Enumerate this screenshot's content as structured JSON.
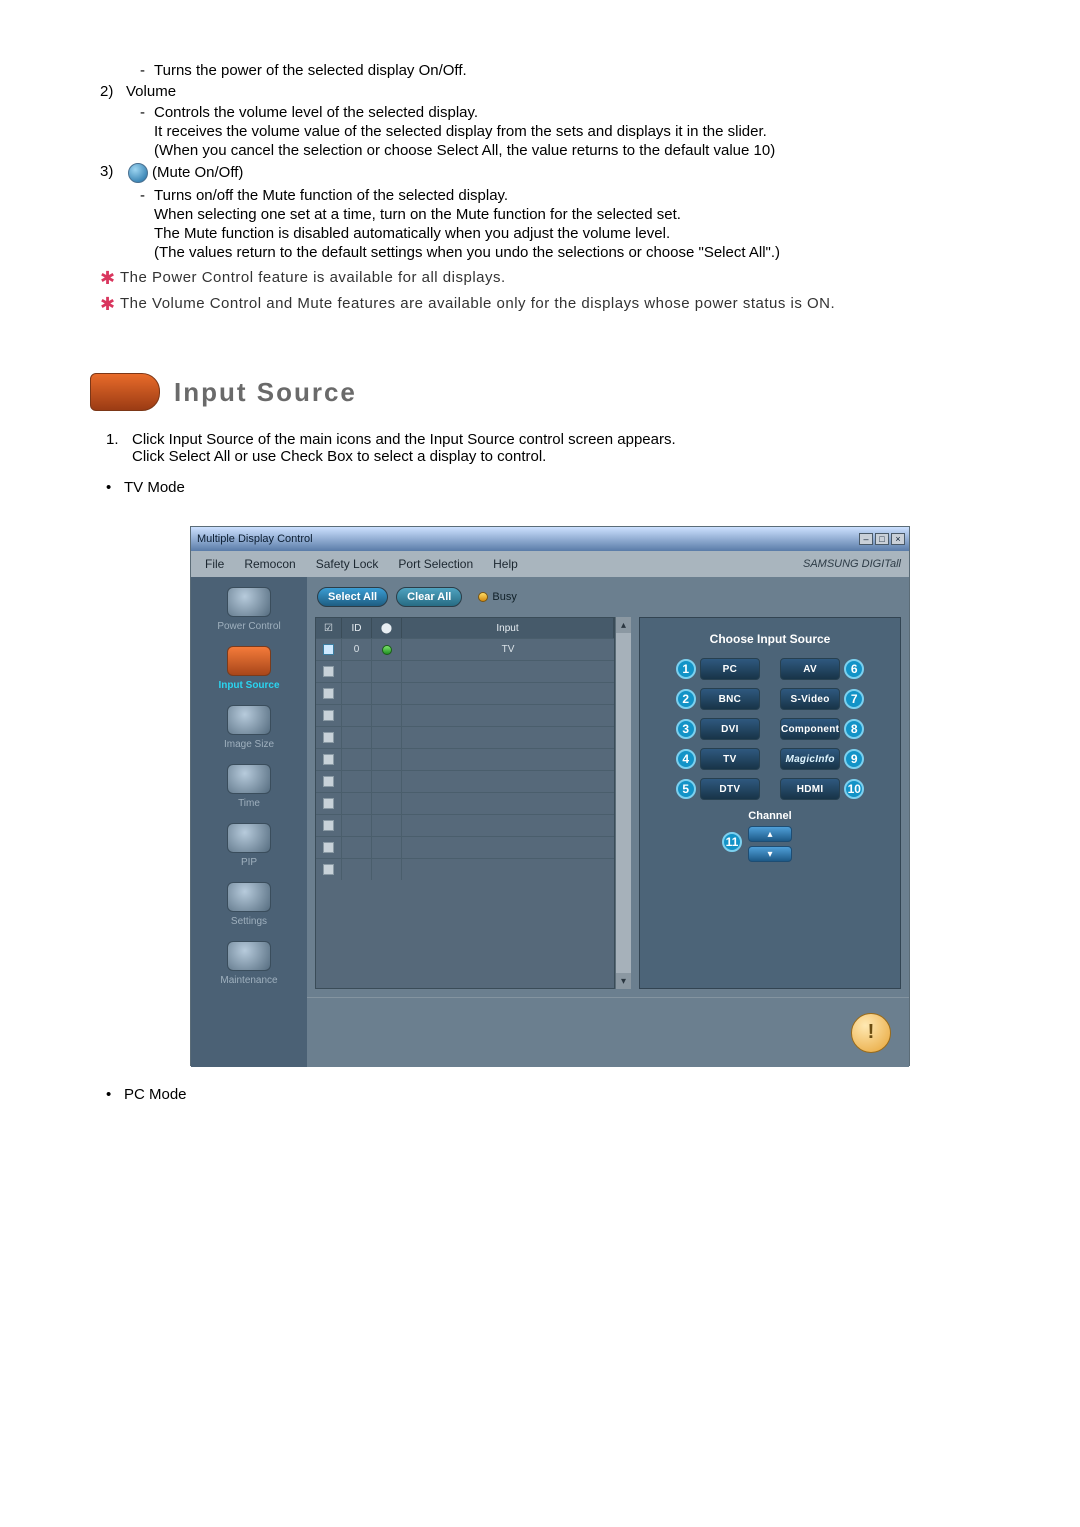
{
  "top": {
    "item1_sub_dash": "Turns the power of the selected display On/Off.",
    "item2_num": "2)",
    "item2_label": "Volume",
    "item2_l1": "Controls the volume level of the selected display.",
    "item2_l2": "It receives the volume value of the selected display from the sets and displays it in the slider.",
    "item2_l3": "(When you cancel the selection or choose Select All, the value returns to the default value 10)",
    "item3_num": "3)",
    "item3_label": "(Mute On/Off)",
    "item3_l1": "Turns on/off the Mute function of the selected display.",
    "item3_l2": "When selecting one set at a time, turn on the Mute function for the selected set.",
    "item3_l3": "The Mute function is disabled automatically when you adjust the volume level.",
    "item3_l4": "(The values return to the default settings when you undo the selections or choose \"Select All\".)",
    "note1": "The Power Control feature is available for all displays.",
    "note2": "The Volume Control and Mute features are available only for the displays whose power status is ON."
  },
  "section": {
    "heading": "Input Source",
    "ol_num": "1.",
    "ol_l1": "Click Input Source of the main icons and the Input Source control screen appears.",
    "ol_l2": "Click Select All or use Check Box to select a display to control.",
    "bul_tv": "TV Mode",
    "bul_pc": "PC Mode"
  },
  "win": {
    "title": "Multiple Display Control",
    "menu": {
      "file": "File",
      "remocon": "Remocon",
      "safety": "Safety Lock",
      "port": "Port Selection",
      "help": "Help"
    },
    "brand": "SAMSUNG DIGITall",
    "sidebar": {
      "power": "Power Control",
      "input": "Input Source",
      "image": "Image Size",
      "time": "Time",
      "pip": "PIP",
      "settings": "Settings",
      "maint": "Maintenance"
    },
    "toolbar": {
      "select_all": "Select All",
      "clear_all": "Clear All",
      "busy": "Busy"
    },
    "table": {
      "h_chk": "☑",
      "h_id": "ID",
      "h_stat": "●",
      "h_input": "Input",
      "row0_id": "0",
      "row0_input": "TV"
    },
    "panel": {
      "title": "Choose Input Source",
      "sources": {
        "pc": "PC",
        "bnc": "BNC",
        "dvi": "DVI",
        "tv": "TV",
        "dtv": "DTV",
        "av": "AV",
        "svideo": "S-Video",
        "component": "Component",
        "magicinfo": "MagicInfo",
        "hdmi": "HDMI"
      },
      "badges": {
        "b1": "1",
        "b2": "2",
        "b3": "3",
        "b4": "4",
        "b5": "5",
        "b6": "6",
        "b7": "7",
        "b8": "8",
        "b9": "9",
        "b10": "10",
        "b11": "11"
      },
      "channel": "Channel"
    }
  }
}
